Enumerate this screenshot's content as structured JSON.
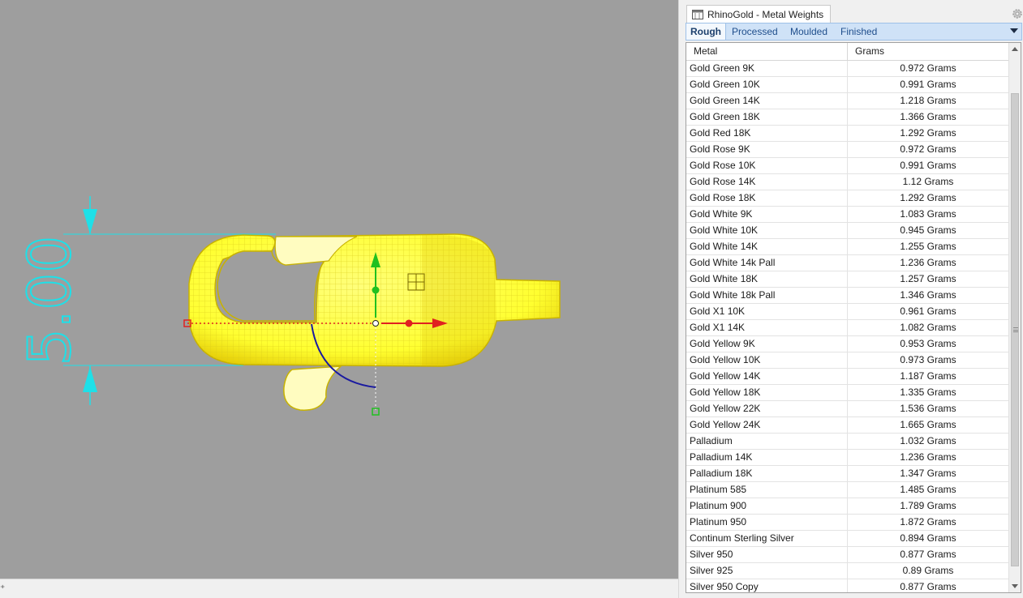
{
  "viewport": {
    "dimension_text": "5.00",
    "colors": {
      "background": "#9e9e9e",
      "model": "#ffff3a",
      "dimension": "#1ee0e8",
      "gumball_x": "#e02020",
      "gumball_y": "#20c020",
      "gumball_arc": "#1a1aa0"
    }
  },
  "statusbar": {
    "grip_glyph": "⁺"
  },
  "panel": {
    "title": "RhinoGold - Metal Weights",
    "title_icon": "window-icon",
    "gear_icon": "gear-icon",
    "tabs": [
      {
        "label": "Rough",
        "active": true
      },
      {
        "label": "Processed",
        "active": false
      },
      {
        "label": "Moulded",
        "active": false
      },
      {
        "label": "Finished",
        "active": false
      }
    ],
    "menu_icon": "triangle-down-icon"
  },
  "table": {
    "columns": [
      "Metal",
      "Grams"
    ],
    "rows": [
      {
        "metal": "Gold Green 9K",
        "grams": "0.972 Grams"
      },
      {
        "metal": "Gold Green 10K",
        "grams": "0.991 Grams"
      },
      {
        "metal": "Gold Green 14K",
        "grams": "1.218 Grams"
      },
      {
        "metal": "Gold Green 18K",
        "grams": "1.366 Grams"
      },
      {
        "metal": "Gold Red 18K",
        "grams": "1.292 Grams"
      },
      {
        "metal": "Gold Rose 9K",
        "grams": "0.972 Grams"
      },
      {
        "metal": "Gold Rose 10K",
        "grams": "0.991 Grams"
      },
      {
        "metal": "Gold Rose 14K",
        "grams": "1.12 Grams"
      },
      {
        "metal": "Gold Rose 18K",
        "grams": "1.292 Grams"
      },
      {
        "metal": "Gold White 9K",
        "grams": "1.083 Grams"
      },
      {
        "metal": "Gold White 10K",
        "grams": "0.945 Grams"
      },
      {
        "metal": "Gold White 14K",
        "grams": "1.255 Grams"
      },
      {
        "metal": "Gold White 14k Pall",
        "grams": "1.236 Grams"
      },
      {
        "metal": "Gold White 18K",
        "grams": "1.257 Grams"
      },
      {
        "metal": "Gold White 18k Pall",
        "grams": "1.346 Grams"
      },
      {
        "metal": "Gold X1 10K",
        "grams": "0.961 Grams"
      },
      {
        "metal": "Gold X1 14K",
        "grams": "1.082 Grams"
      },
      {
        "metal": "Gold Yellow 9K",
        "grams": "0.953 Grams"
      },
      {
        "metal": "Gold Yellow 10K",
        "grams": "0.973 Grams"
      },
      {
        "metal": "Gold Yellow 14K",
        "grams": "1.187 Grams"
      },
      {
        "metal": "Gold Yellow 18K",
        "grams": "1.335 Grams"
      },
      {
        "metal": "Gold Yellow 22K",
        "grams": "1.536 Grams"
      },
      {
        "metal": "Gold Yellow 24K",
        "grams": "1.665 Grams"
      },
      {
        "metal": "Palladium",
        "grams": "1.032 Grams"
      },
      {
        "metal": "Palladium 14K",
        "grams": "1.236 Grams"
      },
      {
        "metal": "Palladium 18K",
        "grams": "1.347 Grams"
      },
      {
        "metal": "Platinum 585",
        "grams": "1.485 Grams"
      },
      {
        "metal": "Platinum 900",
        "grams": "1.789 Grams"
      },
      {
        "metal": "Platinum 950",
        "grams": "1.872 Grams"
      },
      {
        "metal": "Continum Sterling Silver",
        "grams": "0.894 Grams"
      },
      {
        "metal": "Silver 950",
        "grams": "0.877 Grams"
      },
      {
        "metal": "Silver 925",
        "grams": "0.89 Grams"
      },
      {
        "metal": "Silver 950 Copy",
        "grams": "0.877 Grams"
      }
    ]
  }
}
